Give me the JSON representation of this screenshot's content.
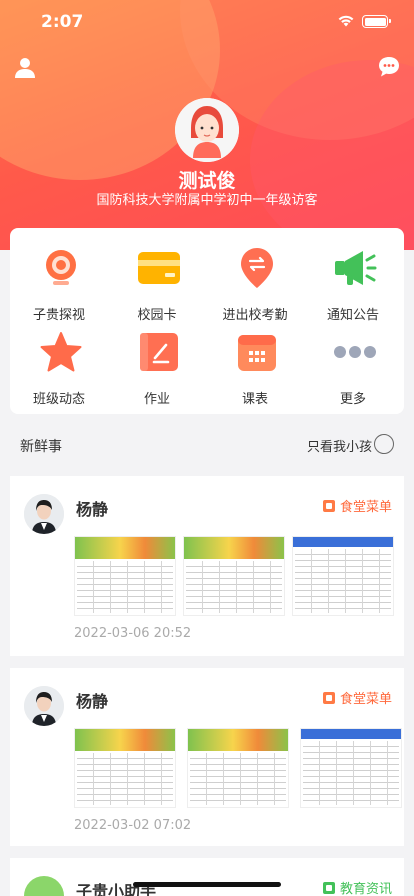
{
  "status_bar": {
    "time": "2:07"
  },
  "profile": {
    "name": "测试俊",
    "subtitle": "国防科技大学附属中学初中一年级访客"
  },
  "menu": [
    {
      "label": "子贵探视",
      "icon": "camera-icon",
      "color": "#ff7043"
    },
    {
      "label": "校园卡",
      "icon": "card-icon",
      "color": "#ffb300"
    },
    {
      "label": "进出校考勤",
      "icon": "location-exchange-icon",
      "color": "#ff6f52"
    },
    {
      "label": "通知公告",
      "icon": "megaphone-icon",
      "color": "#43c159"
    },
    {
      "label": "班级动态",
      "icon": "star-icon",
      "color": "#ff6b4a"
    },
    {
      "label": "作业",
      "icon": "homework-book-icon",
      "color": "#ff6f52"
    },
    {
      "label": "课表",
      "icon": "calendar-icon",
      "color": "#ff7043"
    },
    {
      "label": "更多",
      "icon": "more-dots-icon",
      "color": "#9ea6b8"
    }
  ],
  "news": {
    "title": "新鲜事",
    "filter_label": "只看我小孩"
  },
  "posts": [
    {
      "author": "杨静",
      "tag": "食堂菜单",
      "time": "2022-03-06 20:52"
    },
    {
      "author": "杨静",
      "tag": "食堂菜单",
      "time": "2022-03-02 07:02"
    },
    {
      "author": "子贵小助手",
      "tag": "教育资讯"
    }
  ],
  "colors": {
    "accent": "#ff5a4a",
    "tag": "#ff6a3d",
    "edu_tag": "#43c159"
  }
}
